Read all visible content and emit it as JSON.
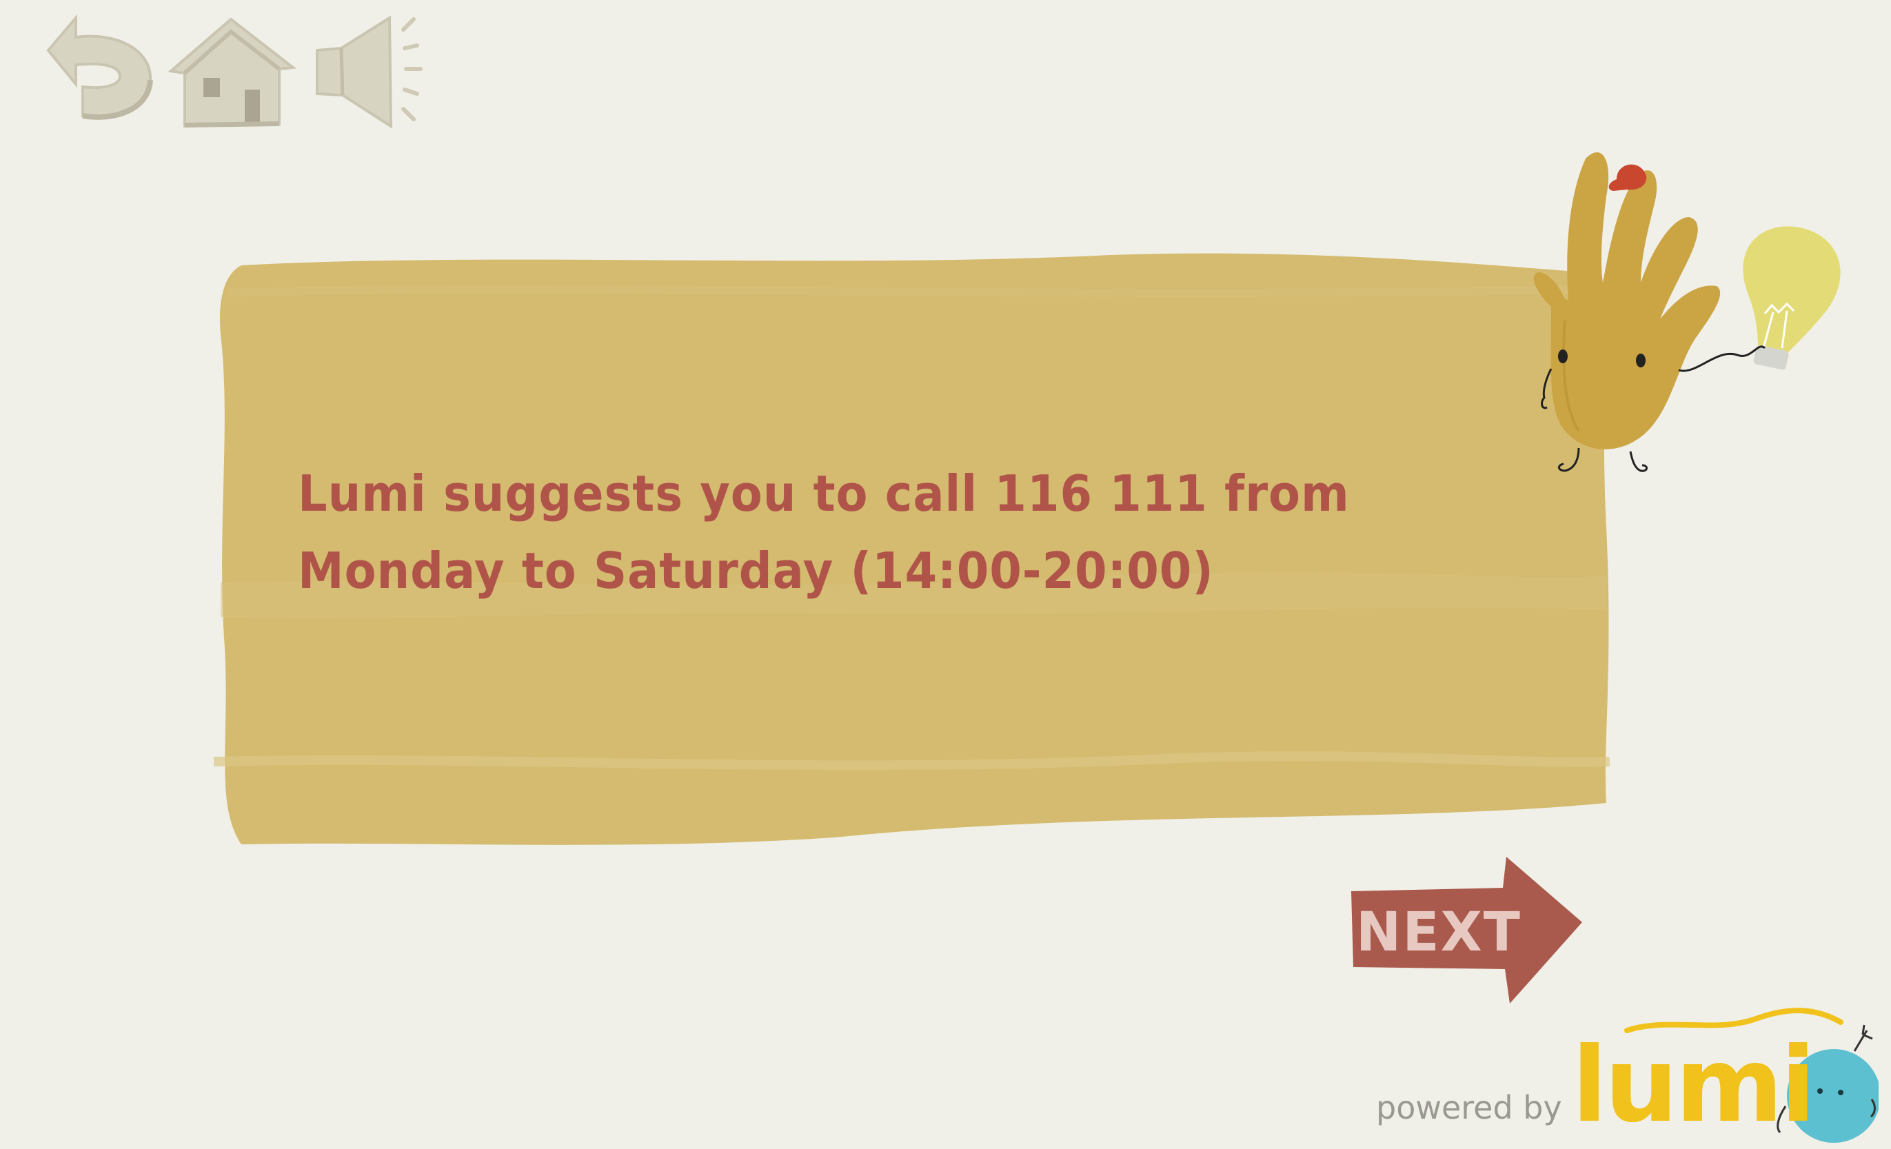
{
  "toolbar": {
    "back_icon": "back-arrow-icon",
    "home_icon": "house-icon",
    "sound_icon": "speaker-icon"
  },
  "message": {
    "text": "Lumi suggests you to call 116 111 from Monday to Saturday (14:00-20:00)"
  },
  "navigation": {
    "next_label": "NEXT"
  },
  "footer": {
    "powered_by": "powered by",
    "brand": "lumi"
  },
  "colors": {
    "background": "#f1f0e8",
    "panel": "#d4bb70",
    "text": "#b0544a",
    "next_button": "#a95a4d",
    "next_text": "#e8c9c2",
    "toolbar": "#d8d4c2",
    "brand_yellow": "#f0c21b",
    "brand_blue": "#5cc0d0"
  }
}
